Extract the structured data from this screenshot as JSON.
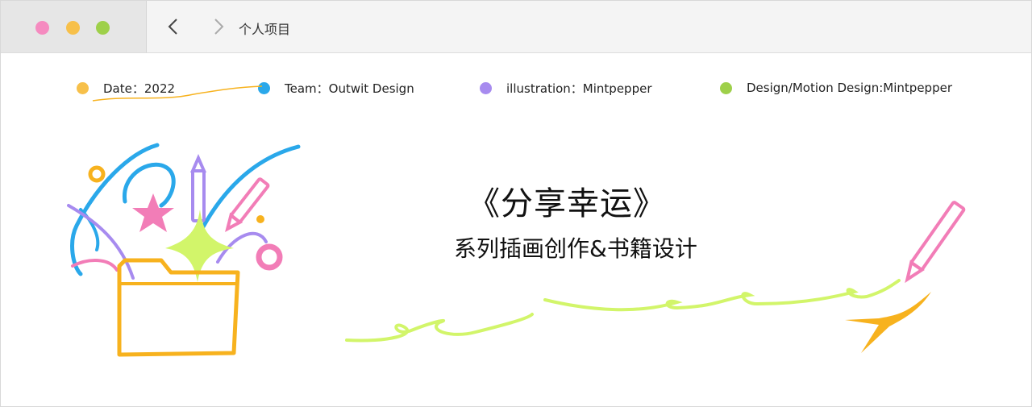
{
  "window": {
    "title": "个人项目",
    "controls": [
      {
        "name": "close",
        "color": "#f58bc0"
      },
      {
        "name": "minimize",
        "color": "#f7c04a"
      },
      {
        "name": "maximize",
        "color": "#9ed04a"
      }
    ]
  },
  "meta": [
    {
      "text": "Date：2022",
      "color": "#f7c04a"
    },
    {
      "text": "Team：Outwit Design",
      "color": "#2aa8ea"
    },
    {
      "text": "illustration：Mintpepper",
      "color": "#a78bef"
    },
    {
      "text": "Design/Motion Design:Mintpepper",
      "color": "#9ed04a"
    }
  ],
  "hero": {
    "title": "《分享幸运》",
    "subtitle": "系列插画创作&书籍设计"
  },
  "colors": {
    "yellow": "#f7b21e",
    "blue": "#2aa8ea",
    "purple": "#a78bef",
    "pink": "#f27db7",
    "lime": "#d2f56a"
  }
}
